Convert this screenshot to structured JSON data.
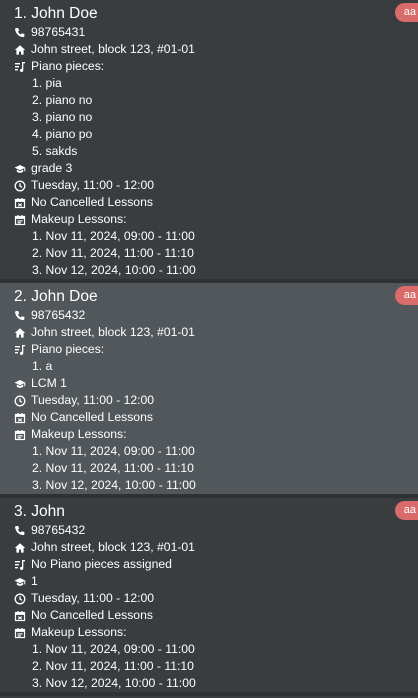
{
  "students": [
    {
      "name": "1. John Doe",
      "tag": "aa",
      "phone": "98765431",
      "address": "John street, block 123, #01-01",
      "pieces_label": "Piano pieces:",
      "pieces": [
        "1. pia",
        "2. piano  no",
        "3. piano no",
        "4. piano po",
        "5. sakds"
      ],
      "grade": "grade 3",
      "time": "Tuesday, 11:00 - 12:00",
      "cancelled": "No Cancelled Lessons",
      "makeup_label": "Makeup Lessons:",
      "makeup": [
        "1. Nov 11, 2024, 09:00 - 11:00",
        "2. Nov 11, 2024, 11:00 - 11:10",
        "3. Nov 12, 2024, 10:00 - 11:00"
      ]
    },
    {
      "name": "2. John Doe",
      "tag": "aa",
      "phone": "98765432",
      "address": "John street, block 123, #01-01",
      "pieces_label": "Piano pieces:",
      "pieces": [
        "1. a"
      ],
      "grade": "LCM 1",
      "time": "Tuesday, 11:00 - 12:00",
      "cancelled": "No Cancelled Lessons",
      "makeup_label": "Makeup Lessons:",
      "makeup": [
        "1. Nov 11, 2024, 09:00 - 11:00",
        "2. Nov 11, 2024, 11:00 - 11:10",
        "3. Nov 12, 2024, 10:00 - 11:00"
      ]
    },
    {
      "name": "3. John",
      "tag": "aa",
      "phone": "98765432",
      "address": "John street, block 123, #01-01",
      "pieces_label": "No Piano pieces assigned",
      "pieces": [],
      "grade": "1",
      "time": "Tuesday, 11:00 - 12:00",
      "cancelled": "No Cancelled Lessons",
      "makeup_label": "Makeup Lessons:",
      "makeup": [
        "1. Nov 11, 2024, 09:00 - 11:00",
        "2. Nov 11, 2024, 11:00 - 11:10",
        "3. Nov 12, 2024, 10:00 - 11:00"
      ]
    }
  ],
  "icons": {
    "phone": "phone-icon",
    "address": "home-icon",
    "pieces": "music-note-icon",
    "grade": "graduation-cap-icon",
    "time": "clock-icon",
    "cancelled": "calendar-icon",
    "makeup": "calendar-icon"
  },
  "colors": {
    "card_alt": "#51575b",
    "card_plain": "#3a3d40",
    "tag": "#d96b6b",
    "text": "#ffffff"
  }
}
